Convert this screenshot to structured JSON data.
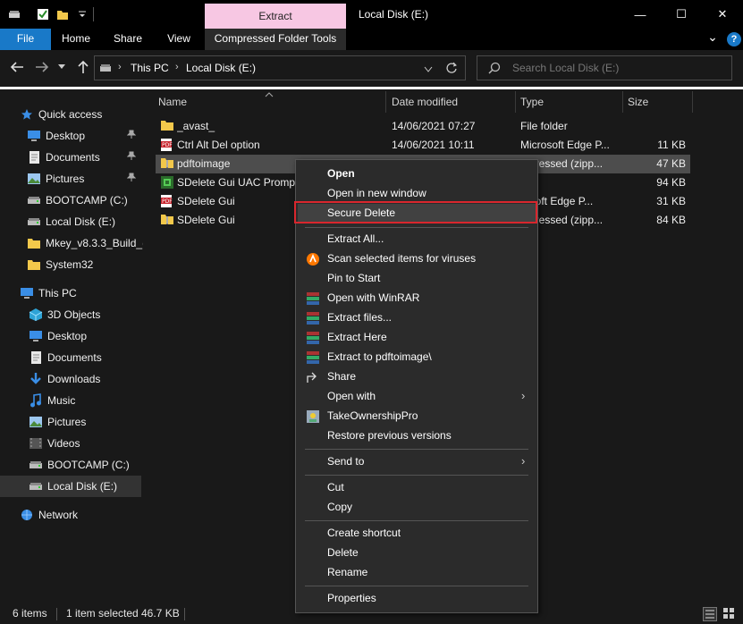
{
  "window": {
    "title": "Local Disk (E:)",
    "minimize_glyph": "—",
    "maximize_glyph": "☐",
    "close_glyph": "✕"
  },
  "ribbon": {
    "context_header": "Extract",
    "tabs": [
      "File",
      "Home",
      "Share",
      "View"
    ],
    "context_tab": "Compressed Folder Tools",
    "collapse_glyph": "⌄",
    "help_glyph": "?"
  },
  "address": {
    "breadcrumbs": [
      "This PC",
      "Local Disk (E:)"
    ],
    "separator": "›",
    "search_placeholder": "Search Local Disk (E:)"
  },
  "nav": {
    "quick_access": "Quick access",
    "quick_items": [
      {
        "label": "Desktop",
        "icon": "desktop-icon",
        "pinned": true
      },
      {
        "label": "Documents",
        "icon": "documents-icon",
        "pinned": true
      },
      {
        "label": "Pictures",
        "icon": "pictures-icon",
        "pinned": true
      },
      {
        "label": "BOOTCAMP (C:)",
        "icon": "drive-icon",
        "pinned": false
      },
      {
        "label": "Local Disk (E:)",
        "icon": "drive-icon",
        "pinned": false
      },
      {
        "label": "Mkey_v8.3.3_Build_(",
        "icon": "folder-icon",
        "pinned": false
      },
      {
        "label": "System32",
        "icon": "folder-icon",
        "pinned": false
      }
    ],
    "this_pc": "This PC",
    "pc_items": [
      {
        "label": "3D Objects",
        "icon": "3d-objects-icon"
      },
      {
        "label": "Desktop",
        "icon": "desktop-icon"
      },
      {
        "label": "Documents",
        "icon": "documents-icon"
      },
      {
        "label": "Downloads",
        "icon": "downloads-icon"
      },
      {
        "label": "Music",
        "icon": "music-icon"
      },
      {
        "label": "Pictures",
        "icon": "pictures-icon"
      },
      {
        "label": "Videos",
        "icon": "videos-icon"
      },
      {
        "label": "BOOTCAMP (C:)",
        "icon": "drive-icon"
      },
      {
        "label": "Local Disk (E:)",
        "icon": "drive-icon",
        "selected": true
      }
    ],
    "network": "Network"
  },
  "columns": [
    "Name",
    "Date modified",
    "Type",
    "Size"
  ],
  "files": [
    {
      "name": "_avast_",
      "date": "14/06/2021 07:27",
      "type": "File folder",
      "size": "",
      "icon": "folder-icon"
    },
    {
      "name": "Ctrl Alt Del option",
      "date": "14/06/2021 10:11",
      "type": "Microsoft Edge P...",
      "size": "11 KB",
      "icon": "pdf-icon"
    },
    {
      "name": "pdftoimage",
      "date": "",
      "type": "mpressed (zipp...",
      "size": "47 KB",
      "icon": "zip-icon",
      "selected": true
    },
    {
      "name": "SDelete Gui UAC Prompt",
      "date": "",
      "type": "File",
      "size": "94 KB",
      "icon": "app-icon"
    },
    {
      "name": "SDelete Gui",
      "date": "",
      "type": "rosoft Edge P...",
      "size": "31 KB",
      "icon": "pdf-icon"
    },
    {
      "name": "SDelete Gui",
      "date": "",
      "type": "mpressed (zipp...",
      "size": "84 KB",
      "icon": "zip-icon"
    }
  ],
  "context_menu": {
    "open": "Open",
    "open_new_window": "Open in new window",
    "secure_delete": "Secure Delete",
    "extract_all": "Extract All...",
    "scan": "Scan selected items for viruses",
    "pin_start": "Pin to Start",
    "open_winrar": "Open with WinRAR",
    "extract_files": "Extract files...",
    "extract_here": "Extract Here",
    "extract_to": "Extract to pdftoimage\\",
    "share": "Share",
    "open_with": "Open with",
    "take_ownership": "TakeOwnershipPro",
    "restore_versions": "Restore previous versions",
    "send_to": "Send to",
    "cut": "Cut",
    "copy": "Copy",
    "create_shortcut": "Create shortcut",
    "delete": "Delete",
    "rename": "Rename",
    "properties": "Properties"
  },
  "status": {
    "items": "6 items",
    "selected": "1 item selected",
    "size": "46.7 KB"
  },
  "colors": {
    "accent": "#1979c8",
    "context_tab": "#f7c7e3",
    "highlight_border": "#d9262d"
  }
}
